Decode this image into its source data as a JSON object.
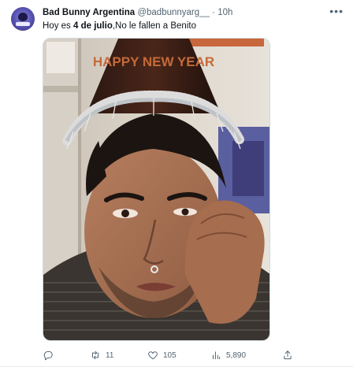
{
  "tweet": {
    "display_name": "Bad Bunny Argentina",
    "handle": "@badbunnyarg__",
    "separator": "·",
    "time": "10h",
    "text_pre": "Hoy es ",
    "text_bold": "4 de julio",
    "text_post": ",No le fallen a Benito",
    "avatar_label": "BBA"
  },
  "media": {
    "hat_text": "HAPPY NEW YEAR"
  },
  "actions": {
    "reply": {
      "icon": "reply-icon",
      "count": ""
    },
    "retweet": {
      "icon": "retweet-icon",
      "count": "11"
    },
    "like": {
      "icon": "heart-icon",
      "count": "105"
    },
    "views": {
      "icon": "views-icon",
      "count": "5,890"
    },
    "share": {
      "icon": "share-icon",
      "count": ""
    }
  },
  "colors": {
    "text_primary": "#0f1419",
    "text_secondary": "#536471",
    "border": "#cfd9de"
  }
}
